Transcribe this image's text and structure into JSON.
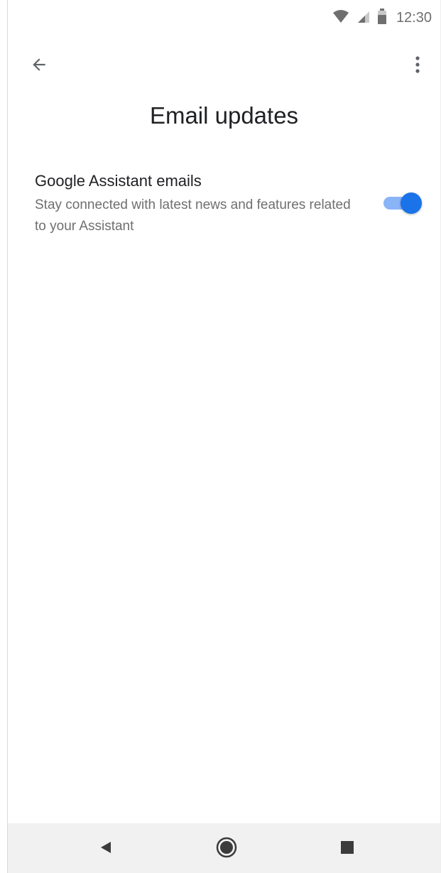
{
  "status_bar": {
    "time": "12:30",
    "icons": [
      "wifi-icon",
      "signal-icon",
      "battery-icon"
    ]
  },
  "toolbar": {
    "back_icon": "arrow-back-icon",
    "more_icon": "more-vert-icon"
  },
  "page": {
    "title": "Email updates"
  },
  "setting": {
    "title": "Google Assistant emails",
    "description": "Stay connected with latest news and features related to your Assistant",
    "enabled": true
  },
  "nav_bar": {
    "icons": [
      "back-triangle-icon",
      "home-circle-icon",
      "recents-square-icon"
    ]
  },
  "colors": {
    "accent": "#1a73e8",
    "track": "#8ab4f8",
    "title_text": "#202124",
    "secondary_text": "#6f6f6f",
    "nav_bar_bg": "#f1f1f1"
  }
}
